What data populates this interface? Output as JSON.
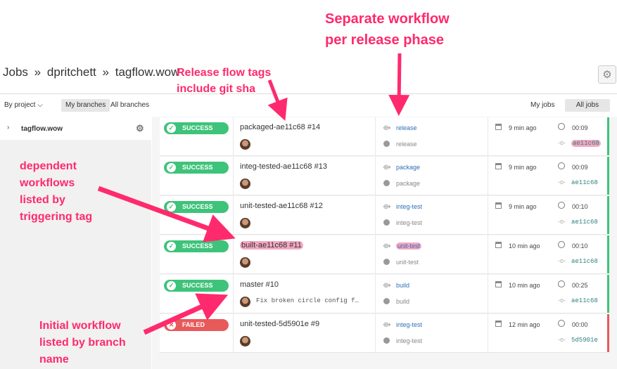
{
  "breadcrumb": {
    "jobs": "Jobs",
    "sep1": "»",
    "user": "dpritchett",
    "sep2": "»",
    "project": "tagflow.wow"
  },
  "filters": {
    "by_project": "By project",
    "my_branches": "My branches",
    "all_branches": "All branches",
    "my_jobs": "My jobs",
    "all_jobs": "All jobs"
  },
  "sidebar": {
    "project": "tagflow.wow"
  },
  "colors": {
    "success": "#3ec37a",
    "failed": "#e85a5a",
    "annotation": "#ff2a6d"
  },
  "icons": {
    "settings": "gear-icon",
    "expand": "chevron-right-icon",
    "status": "check-circle-icon",
    "failed": "x-circle-icon"
  },
  "builds": [
    {
      "status": "SUCCESS",
      "workflow": "packaged-ae11c68 #14",
      "job_link": "release",
      "job_name": "release",
      "ago": "9 min ago",
      "duration": "00:09",
      "sha": "ae11c68",
      "commit": ""
    },
    {
      "status": "SUCCESS",
      "workflow": "integ-tested-ae11c68 #13",
      "job_link": "package",
      "job_name": "package",
      "ago": "9 min ago",
      "duration": "00:09",
      "sha": "ae11c68",
      "commit": ""
    },
    {
      "status": "SUCCESS",
      "workflow": "unit-tested-ae11c68 #12",
      "job_link": "integ-test",
      "job_name": "integ-test",
      "ago": "9 min ago",
      "duration": "00:10",
      "sha": "ae11c68",
      "commit": ""
    },
    {
      "status": "SUCCESS",
      "workflow": "built-ae11c68 #11",
      "job_link": "unit-test",
      "job_name": "unit-test",
      "ago": "10 min ago",
      "duration": "00:10",
      "sha": "ae11c68",
      "commit": ""
    },
    {
      "status": "SUCCESS",
      "workflow": "master #10",
      "job_link": "build",
      "job_name": "build",
      "ago": "10 min ago",
      "duration": "00:25",
      "sha": "ae11c68",
      "commit": "Fix broken circle config f…"
    },
    {
      "status": "FAILED",
      "workflow": "unit-tested-5d5901e #9",
      "job_link": "integ-test",
      "job_name": "integ-test",
      "ago": "12 min ago",
      "duration": "00:00",
      "sha": "5d5901e",
      "commit": ""
    }
  ],
  "annotations": {
    "separate": [
      "Separate workflow",
      "per release phase"
    ],
    "release_tags": [
      "Release flow tags",
      "include git sha"
    ],
    "dependent": [
      "dependent",
      "workflows",
      "listed by",
      "triggering tag"
    ],
    "initial": [
      "Initial workflow",
      "listed by branch",
      "name"
    ]
  }
}
